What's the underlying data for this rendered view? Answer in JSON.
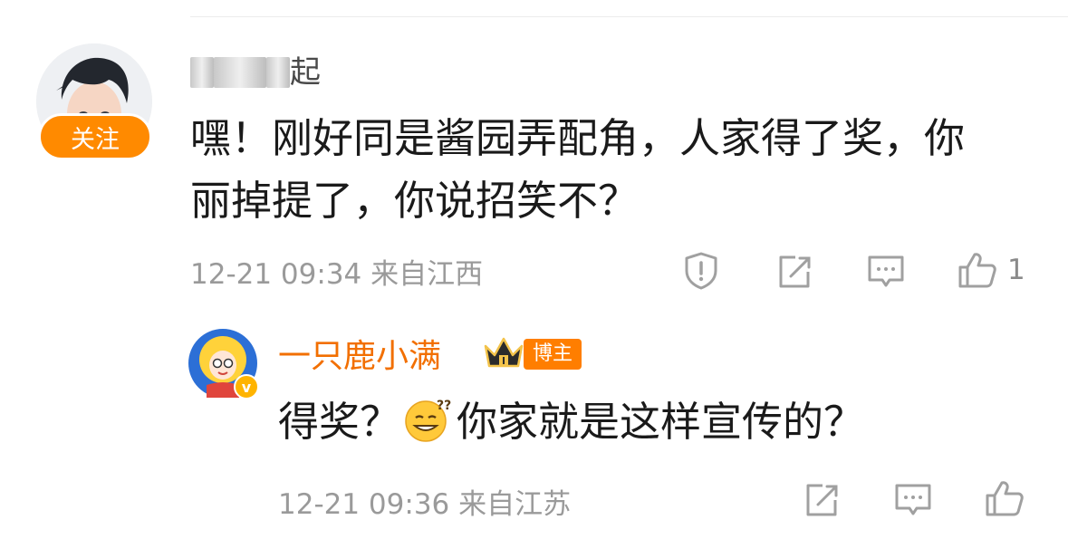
{
  "comment": {
    "username_visible": "起",
    "follow_label": "关注",
    "text": "嘿！刚好同是酱园弄配角，人家得了奖，你丽掉提了，你说招笑不？",
    "meta": "12-21 09:34 来自江西",
    "like_count": "1"
  },
  "reply": {
    "username": "一只鹿小满",
    "badge_label": "博主",
    "verified_mark": "v",
    "text_before": "得奖？",
    "emoji": "confused-smile-emoji",
    "text_after": "你家就是这样宣传的？",
    "meta": "12-21 09:36 来自江苏"
  },
  "icons": [
    "report-icon",
    "share-icon",
    "comment-icon",
    "like-icon"
  ],
  "colors": {
    "accent_orange": "#ff8a00",
    "blogger_name": "#f26f00",
    "meta_gray": "#9a9a9a"
  }
}
